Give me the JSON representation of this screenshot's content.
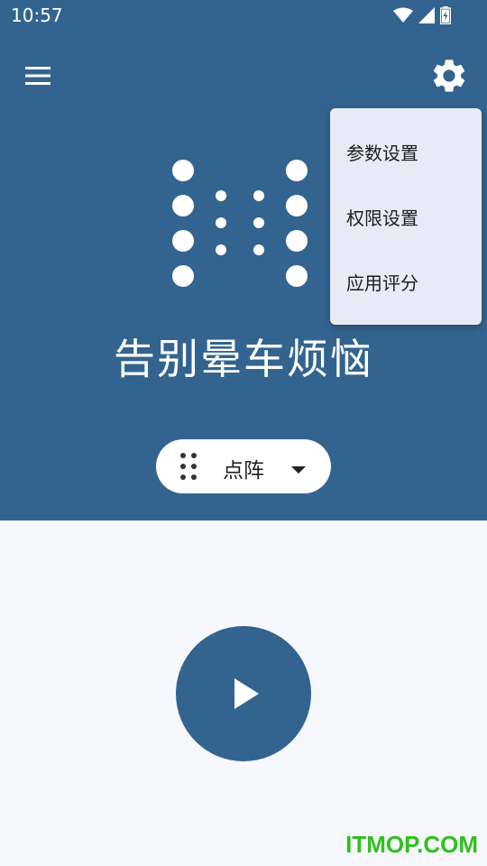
{
  "status_bar": {
    "time": "10:57",
    "icons": [
      "wifi-icon",
      "cell-signal-icon",
      "battery-charging-icon"
    ]
  },
  "toolbar": {
    "menu_icon": "hamburger-menu-icon",
    "settings_icon": "gear-icon"
  },
  "hero": {
    "logo_icon": "dot-matrix-logo",
    "tagline": "告别晕车烦恼"
  },
  "mode_selector": {
    "icon": "dot-grid-icon",
    "selected": "点阵",
    "caret_icon": "caret-down-icon"
  },
  "play_button": {
    "icon": "play-icon"
  },
  "popup_menu": {
    "items": [
      {
        "label": "参数设置"
      },
      {
        "label": "权限设置"
      },
      {
        "label": "应用评分"
      }
    ]
  },
  "watermark": "ITMOP.COM",
  "colors": {
    "primary": "#33648f",
    "background": "#f7f8fd",
    "menu_background": "#e6ebf6",
    "watermark": "#30c01e"
  }
}
